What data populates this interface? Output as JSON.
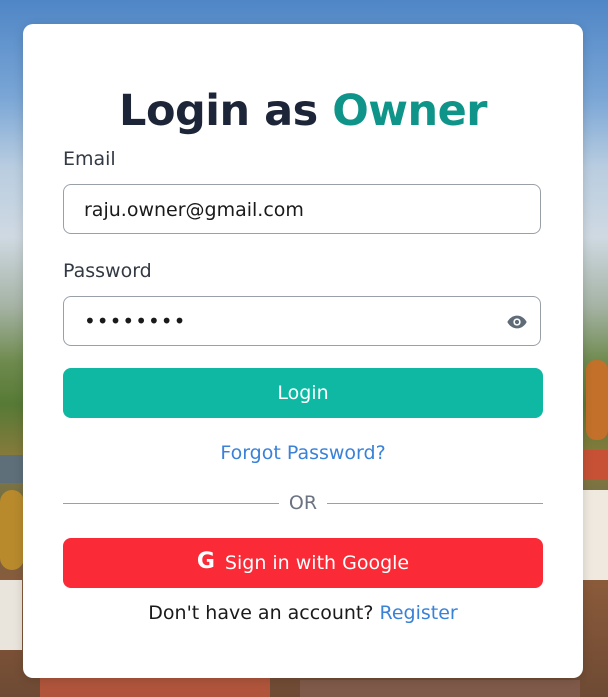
{
  "page": {
    "title_prefix": "Login as",
    "title_accent": "Owner"
  },
  "form": {
    "email_label": "Email",
    "email_value": "raju.owner@gmail.com",
    "password_label": "Password",
    "password_value": "••••••••",
    "login_button": "Login",
    "forgot_link": "Forgot Password?",
    "divider_text": "OR",
    "google_button": "Sign in with Google",
    "google_icon": "G",
    "register_prompt": "Don't have an account?",
    "register_link": "Register"
  },
  "colors": {
    "accent": "#0e9488",
    "login_button": "#0fb8a3",
    "google_button": "#fa2a37",
    "link": "#3a82d8"
  }
}
